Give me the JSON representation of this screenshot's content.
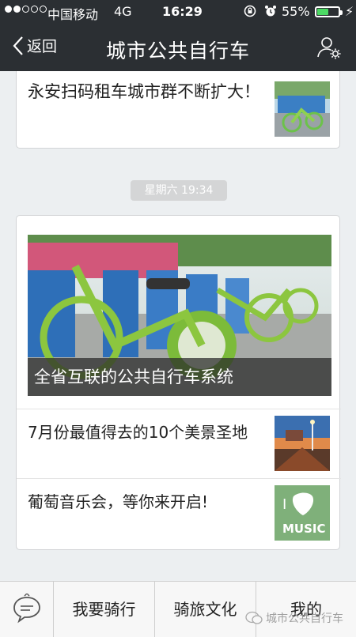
{
  "status": {
    "carrier": "中国移动",
    "network": "4G",
    "time": "16:29",
    "battery_pct": "55%",
    "battery_level": 0.55
  },
  "nav": {
    "back_label": "返回",
    "title": "城市公共自行车"
  },
  "articles_top": {
    "title": "永安扫码租车城市群不断扩大！"
  },
  "time_divider": "星期六 19:34",
  "card": {
    "hero_caption": "全省互联的公共自行车系统",
    "items": [
      {
        "title": "7月份最值得去的10个美景圣地"
      },
      {
        "title": "葡萄音乐会，等你来开启!"
      }
    ]
  },
  "tabs": {
    "items": [
      "我要骑行",
      "骑旅文化",
      "我的"
    ]
  },
  "watermark": "城市公共自行车",
  "thumb_music_text": "MUSIC",
  "thumb_music_letter": "I"
}
